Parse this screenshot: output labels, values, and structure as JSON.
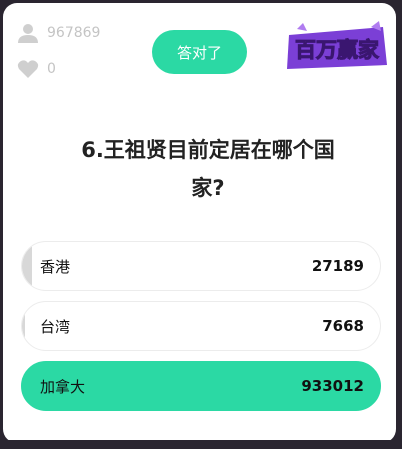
{
  "stats": {
    "viewers": "967869",
    "viewers_icon": "user-icon",
    "likes": "0",
    "likes_icon": "heart-icon"
  },
  "status_badge": "答对了",
  "logo_text": "百万赢家",
  "question": {
    "line1": "6.王祖贤目前定居在哪个国",
    "line2": "家?"
  },
  "options": [
    {
      "label": "香港",
      "count": "27189",
      "share": 0.0281,
      "correct": false
    },
    {
      "label": "台湾",
      "count": "7668",
      "share": 0.0079,
      "correct": false
    },
    {
      "label": "加拿大",
      "count": "933012",
      "share": 0.964,
      "correct": true
    }
  ],
  "colors": {
    "accent": "#2bd9a4",
    "logo_purple": "#7b3fd6"
  }
}
